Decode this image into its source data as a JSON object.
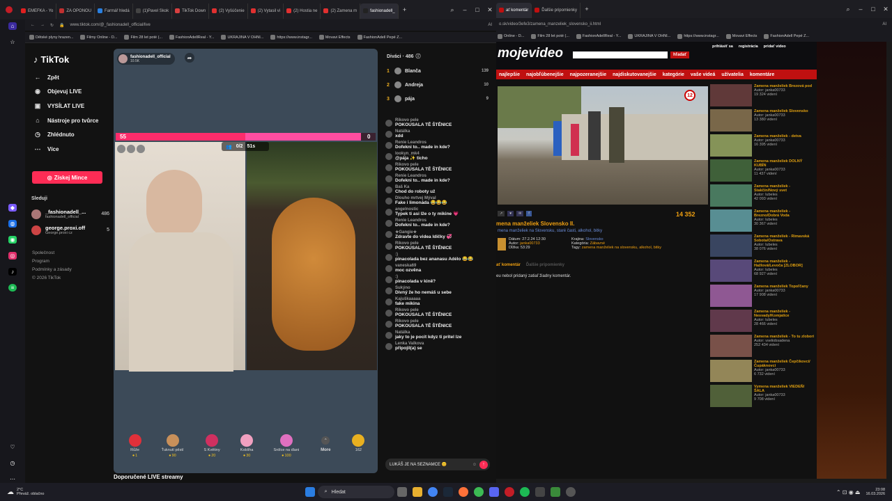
{
  "left_browser": {
    "tabs": [
      "EMEFKA - Yo",
      "ZA OPONOU",
      "Farmář hledá",
      "(1)Pavel Skok",
      "TikTok Down",
      "(2) Vyšúčenie",
      "(2) Vytasil vi",
      "(2) Hostia ne",
      "(2) Zamena m",
      "fashionadell_"
    ],
    "url": "www.tiktok.com/@_fashionadell_official/live",
    "bookmarks": [
      "Dětské plyny hrazen...",
      "Filmy Online - D...",
      "Film 28 let poté (...",
      "FashionAdellReal - Y...",
      "UKRAJINA V OHNI...",
      "https://www.instagr...",
      "Movavi Effects",
      "FashionAdell Pepé Z..."
    ]
  },
  "tiktok": {
    "logo": "TikTok",
    "nav": [
      {
        "label": "Zpět",
        "icon": "←"
      },
      {
        "label": "Objevuj LIVE",
        "icon": "◉"
      },
      {
        "label": "VYSÍLAT LIVE",
        "icon": "▣"
      },
      {
        "label": "Nástroje pro tvůrce",
        "icon": "⌂"
      },
      {
        "label": "Zhlédnuto",
        "icon": "◷"
      },
      {
        "label": "Více",
        "icon": "⋯"
      }
    ],
    "coin_button": "Získej Mince",
    "following_title": "Sleduji",
    "following": [
      {
        "name": "_fashionadell_...",
        "sub": "fashionadell_official",
        "count": "486"
      },
      {
        "name": "george.proxi.off",
        "sub": "George.proxi cz",
        "count": "5"
      }
    ],
    "footer": [
      "Společnost",
      "Program",
      "Podmínky a zásady",
      "© 2026 TikTok"
    ],
    "host_name": "fashionadell_official",
    "host_likes": "10.5K",
    "battle_left": "55",
    "battle_right": "0",
    "battle_players": "0/2",
    "battle_time": "51s",
    "gifts": [
      {
        "name": "Růže",
        "price": "1",
        "color": "#e0303a"
      },
      {
        "name": "Ťuknutí pěstí",
        "price": "90",
        "color": "#c8905a"
      },
      {
        "name": "S Květiny",
        "price": "20",
        "color": "#d03060"
      },
      {
        "name": "Koblíha",
        "price": "30",
        "color": "#f0a0c0"
      },
      {
        "name": "Srdíce na dlani",
        "price": "100",
        "color": "#e070c0"
      }
    ],
    "more_label": "More",
    "coins": "162",
    "recommended": "Doporučené LIVE streamy"
  },
  "chat": {
    "viewers_label": "Diváci · 486",
    "top": [
      {
        "rank": "1",
        "name": "Blanča",
        "score": "139"
      },
      {
        "rank": "2",
        "name": "Andreja",
        "score": "10"
      },
      {
        "rank": "3",
        "name": "pája",
        "score": "9"
      }
    ],
    "messages": [
      {
        "name": "Rikovo pele",
        "msg": "POKOUSALA TĚ ŠTĚNICE"
      },
      {
        "name": "Natálka",
        "msg": "xdd"
      },
      {
        "name": "Renie Leandros",
        "msg": "Dofekni to.. made in kde?"
      },
      {
        "name": "lookyn_mk4",
        "msg": "@pája ✨ ticho"
      },
      {
        "name": "Rikovo pele",
        "msg": "POKOUSALA TĚ ŠTĚNICE"
      },
      {
        "name": "Renie Leandros",
        "msg": "Dofekni to.. made in kde?"
      },
      {
        "name": "Baš Ka",
        "msg": "Chod do roboty už"
      },
      {
        "name": "Dlouho mrtvej Mýval",
        "msg": "Fake i limonáda 😂😂😂"
      },
      {
        "name": "angelnostic",
        "msg": "Typek ti asi lže o ty mikine 💗"
      },
      {
        "name": "Renie Leandros",
        "msg": "Dofekni to.. made in kde?"
      },
      {
        "name": "★Gangie★",
        "msg": "Zdravte do videa ldičky 💞"
      },
      {
        "name": "Rikovo pele",
        "msg": "POKOUSALA TĚ ŠTĚNICE"
      },
      {
        "name": ":)",
        "msg": "pinacolada bez ananasu Adélo 😂😂"
      },
      {
        "name": "vaneska69",
        "msg": "moc ozvěna"
      },
      {
        "name": ":)",
        "msg": "pinacolada v kině?"
      },
      {
        "name": "Sukýno",
        "msg": "Divný že ho nemáš u sebe"
      },
      {
        "name": "Kajuškaaaaa",
        "msg": "fake mikina"
      },
      {
        "name": "Rikovo pele",
        "msg": "POKOUSALA TĚ ŠTĚNICE"
      },
      {
        "name": "Rikovo pele",
        "msg": "POKOUSALA TĚ ŠTĚNICE"
      },
      {
        "name": "Natálka",
        "msg": "jaky to je pocit kdyz ti pritel lze"
      },
      {
        "name": "Lenka Valkova",
        "msg": "připojil(a) se"
      }
    ],
    "input": "LUKÁŠ JE NA SEZNAMCE 😊"
  },
  "right_browser": {
    "tabs": [
      "ať komentár",
      "Ďalšie pripomienky"
    ],
    "url": "o.sk/video/3efe3/zamena_manzeliek_slovensko_ii.html",
    "bookmarks": [
      "Online - D...",
      "Film 28 let poté (...",
      "FashionAdellReal - Y...",
      "UKRAJINA V OHNI...",
      "https://www.instagr...",
      "Movavi Effects",
      "FashionAdell Pepé Z..."
    ],
    "logo": "mojevideo",
    "search_button": "hľadať",
    "header_links": [
      "prihlásiť sa",
      "registrácia",
      "pridať video"
    ],
    "nav": [
      "najlepšie",
      "najobľúbenejšie",
      "najpozeranejšie",
      "najdiskutovanejšie",
      "kategórie",
      "vaše videá",
      "užívatelia",
      "komentáre"
    ],
    "views": "14 352",
    "badge": "12",
    "title": "mena manželiek Slovensko II.",
    "tags_line": "mena manželiek na Slovensku, staré časti, alkohol, bitky",
    "date": "27.2.24 12:30",
    "author": "janka00733",
    "length": "53:29",
    "country": "Slovensko",
    "category": "Zábavné",
    "tags": "zamena manželiek na slovensku, alkohol, bitky",
    "no_comments": "eu nebol pridaný zatiaľ žiadny komentár.",
    "related": [
      {
        "t": "Zamena manželiek Brezová pod",
        "a": "Autor: janka00733",
        "v": "19 324 videní"
      },
      {
        "t": "Zamena manželiek Slovensko",
        "a": "Autor: janka00733",
        "v": "13 380 videní"
      },
      {
        "t": "Zamena manželiek - detva",
        "a": "Autor: janka00733",
        "v": "16 395 videní"
      },
      {
        "t": "Zamena manželiek DOLNÝ KUBÍN",
        "a": "Autor: janka00733",
        "v": "11 437 videní"
      },
      {
        "t": "Zamena manželiek - Stakčín/Nový svet",
        "a": "Autor: lubeles",
        "v": "42 093 videní"
      },
      {
        "t": "Zamena manželiek - Brezno/Dobrá Voda",
        "a": "Autor: lubeles",
        "v": "30 367 videní"
      },
      {
        "t": "Zamena manželiek - Rimavská Sobota/Ostrava",
        "a": "Autor: lubeles",
        "v": "38 076 videní"
      },
      {
        "t": "Zamena manželiek - Hažlová/Levoča [ZLOBOR]",
        "a": "Autor: lubeles",
        "v": "68 927 videní"
      },
      {
        "t": "Zamena manželiek Topoľčany",
        "a": "Autor: janka00733",
        "v": "17 908 videní"
      },
      {
        "t": "Zamena manželiek - Nesvady/Komjatice",
        "a": "Autor: lubeles",
        "v": "28 466 videní"
      },
      {
        "t": "Zamena manželiek - To tu zlobori",
        "a": "Autor: vseliobsadena",
        "v": "252 434 videní"
      },
      {
        "t": "Zamena manželiek Čepčíkovci/Čupáknovci",
        "a": "Autor: janka00733",
        "v": "6 732 videní"
      },
      {
        "t": "Vymena manželiek VIEDEŇ/ŠALA",
        "a": "Autor: janka00733",
        "v": "9 708 videní"
      }
    ]
  },
  "taskbar": {
    "weather_temp": "2°C",
    "weather_text": "Převáž. oblačno",
    "search": "Hledat",
    "time": "23:08",
    "date": "16.03.2026"
  }
}
